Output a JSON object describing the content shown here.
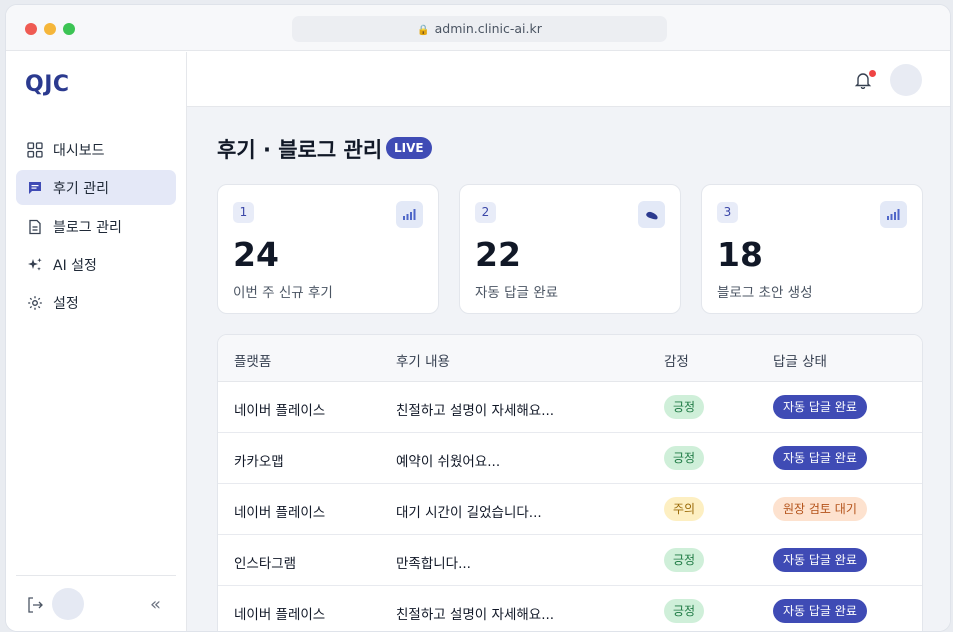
{
  "browser": {
    "url": "admin.clinic-ai.kr"
  },
  "sidebar": {
    "logo": "QJC",
    "items": [
      {
        "label": "대시보드",
        "icon": "dashboard-icon"
      },
      {
        "label": "후기 관리",
        "icon": "chat-icon",
        "active": true
      },
      {
        "label": "블로그 관리",
        "icon": "document-icon"
      },
      {
        "label": "AI 설정",
        "icon": "sparkle-icon"
      },
      {
        "label": "설정",
        "icon": "gear-icon"
      }
    ]
  },
  "page": {
    "title": "후기 · 블로그 관리",
    "badge": "LIVE"
  },
  "stats": [
    {
      "index": "1",
      "value": "24",
      "label": "이번 주 신규 후기",
      "icon": "bar-chart-icon"
    },
    {
      "index": "2",
      "value": "22",
      "label": "자동 답글 완료",
      "icon": "pill-icon"
    },
    {
      "index": "3",
      "value": "18",
      "label": "블로그 초안 생성",
      "icon": "bar-chart-icon"
    }
  ],
  "table": {
    "headers": [
      "플랫폼",
      "후기 내용",
      "감정",
      "답글 상태"
    ],
    "rows": [
      {
        "platform": "네이버 플레이스",
        "content": "친절하고 설명이 자세해요...",
        "sentiment": "긍정",
        "status": "자동 답글 완료"
      },
      {
        "platform": "카카오맵",
        "content": "예약이 쉬웠어요...",
        "sentiment": "긍정",
        "status": "자동 답글 완료"
      },
      {
        "platform": "네이버 플레이스",
        "content": "대기 시간이 길었습니다...",
        "sentiment": "주의",
        "status": "원장 검토 대기"
      },
      {
        "platform": "인스타그램",
        "content": "만족합니다...",
        "sentiment": "긍정",
        "status": "자동 답글 완료"
      },
      {
        "platform": "네이버 플레이스",
        "content": "친절하고 설명이 자세해요...",
        "sentiment": "긍정",
        "status": "자동 답글 완료"
      }
    ]
  },
  "colors": {
    "brand": "#3f4bb5",
    "positive": "#cfefd9",
    "caution": "#fdefc2",
    "pending": "#fde2cf"
  }
}
